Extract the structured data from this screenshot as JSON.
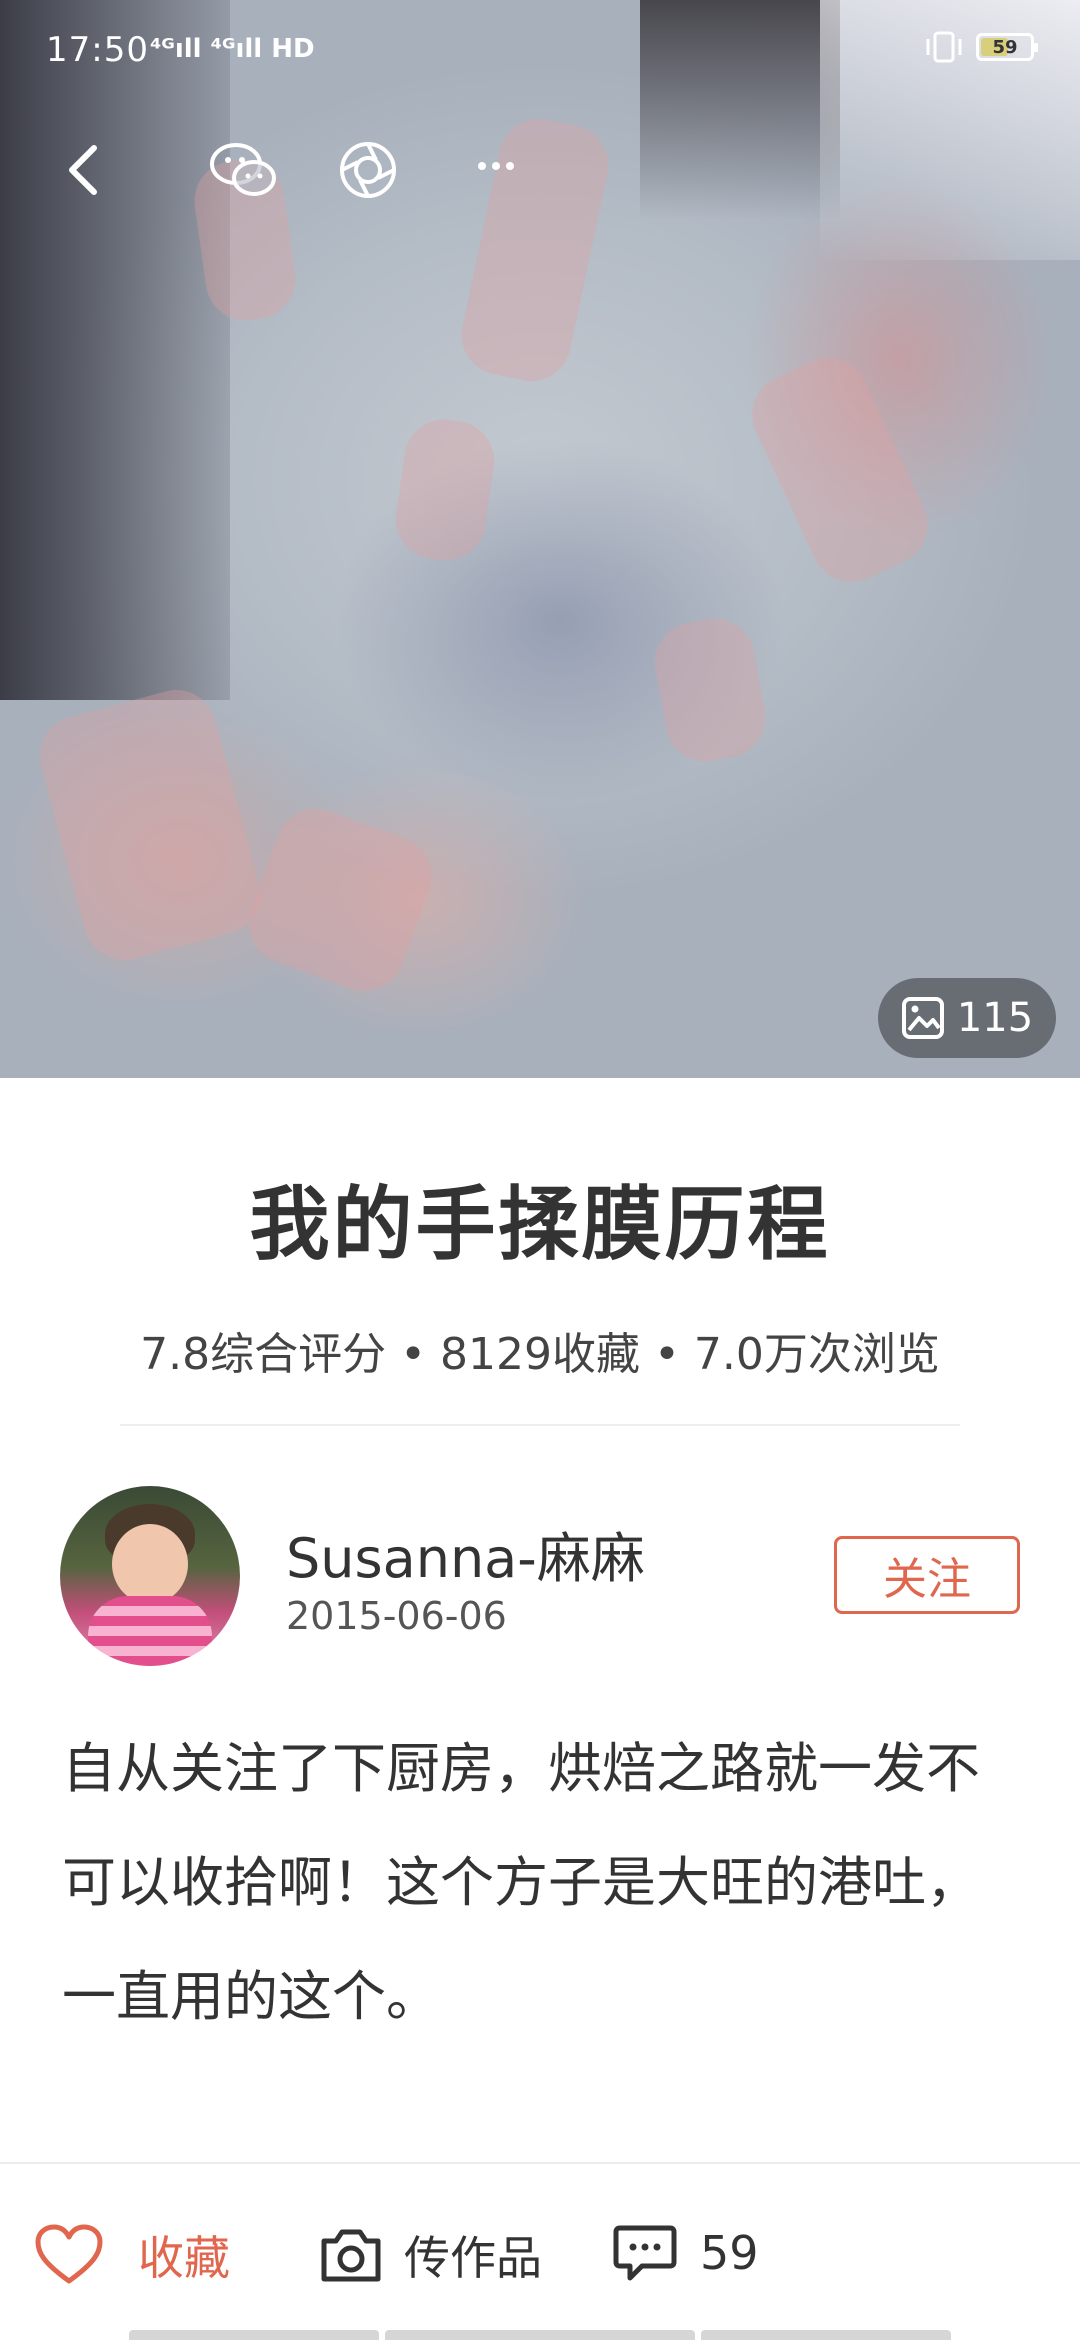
{
  "status_bar": {
    "time": "17:50",
    "signal_text": "⁴ᴳıll ⁴ᴳıll HD",
    "battery_level": "59",
    "battery_fraction": 0.59
  },
  "nav": {
    "back_icon": "chevron-left-icon",
    "wechat_icon": "wechat-icon",
    "moments_icon": "camera-shutter-icon",
    "more_icon": "more-dots-icon"
  },
  "hero": {
    "photo_count": "115",
    "photo_icon": "image-icon"
  },
  "recipe": {
    "title": "我的手揉膜历程",
    "stats": "7.8综合评分 • 8129收藏 • 7.0万次浏览"
  },
  "author": {
    "name": "Susanna-麻麻",
    "date": "2015-06-06",
    "follow_label": "关注"
  },
  "description": "自从关注了下厨房，烘焙之路就一发不可以收拾啊！这个方子是大旺的港吐，一直用的这个。",
  "bottom_bar": {
    "favorite_label": "收藏",
    "upload_label": "传作品",
    "comment_count": "59"
  },
  "colors": {
    "accent": "#e0664d",
    "text": "#333333"
  }
}
